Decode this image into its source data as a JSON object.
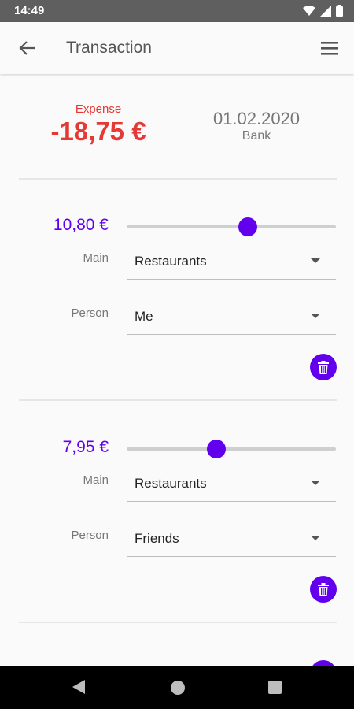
{
  "status_bar": {
    "time": "14:49"
  },
  "app_bar": {
    "title": "Transaction",
    "back_icon": "arrow-back-icon",
    "menu_icon": "hamburger-menu-icon"
  },
  "summary": {
    "type_label": "Expense",
    "amount": "-18,75 €",
    "date": "01.02.2020",
    "account": "Bank"
  },
  "labels": {
    "main": "Main",
    "person": "Person"
  },
  "splits": [
    {
      "amount": "10,80 €",
      "slider_fraction": 0.58,
      "main": "Restaurants",
      "person": "Me"
    },
    {
      "amount": "7,95 €",
      "slider_fraction": 0.43,
      "main": "Restaurants",
      "person": "Friends"
    }
  ],
  "colors": {
    "accent": "#6200ee",
    "expense": "#e53935"
  }
}
